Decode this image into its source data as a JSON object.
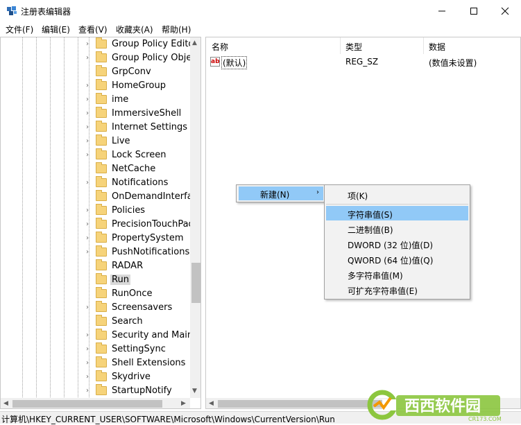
{
  "window": {
    "title": "注册表编辑器",
    "controls": [
      "minimize",
      "maximize",
      "close"
    ]
  },
  "menubar": [
    {
      "label": "文件(F)"
    },
    {
      "label": "编辑(E)"
    },
    {
      "label": "查看(V)"
    },
    {
      "label": "收藏夹(A)"
    },
    {
      "label": "帮助(H)"
    }
  ],
  "tree": {
    "items": [
      {
        "label": "Group Policy Editor",
        "expandable": true
      },
      {
        "label": "Group Policy Objects",
        "expandable": true
      },
      {
        "label": "GrpConv",
        "expandable": false
      },
      {
        "label": "HomeGroup",
        "expandable": true
      },
      {
        "label": "ime",
        "expandable": true
      },
      {
        "label": "ImmersiveShell",
        "expandable": true
      },
      {
        "label": "Internet Settings",
        "expandable": true
      },
      {
        "label": "Live",
        "expandable": true
      },
      {
        "label": "Lock Screen",
        "expandable": true
      },
      {
        "label": "NetCache",
        "expandable": false
      },
      {
        "label": "Notifications",
        "expandable": true
      },
      {
        "label": "OnDemandInterfaceCache",
        "expandable": false
      },
      {
        "label": "Policies",
        "expandable": true
      },
      {
        "label": "PrecisionTouchPad",
        "expandable": true
      },
      {
        "label": "PropertySystem",
        "expandable": true
      },
      {
        "label": "PushNotifications",
        "expandable": true
      },
      {
        "label": "RADAR",
        "expandable": false
      },
      {
        "label": "Run",
        "expandable": false,
        "selected": true
      },
      {
        "label": "RunOnce",
        "expandable": false
      },
      {
        "label": "Screensavers",
        "expandable": true
      },
      {
        "label": "Search",
        "expandable": false
      },
      {
        "label": "Security and Maintenance",
        "expandable": true
      },
      {
        "label": "SettingSync",
        "expandable": true
      },
      {
        "label": "Shell Extensions",
        "expandable": true
      },
      {
        "label": "Skydrive",
        "expandable": true
      },
      {
        "label": "StartupNotify",
        "expandable": true
      }
    ]
  },
  "list": {
    "columns": {
      "name": "名称",
      "type": "类型",
      "data": "数据"
    },
    "rows": [
      {
        "name": "(默认)",
        "type": "REG_SZ",
        "data": "(数值未设置)"
      }
    ]
  },
  "context_menu": {
    "parent_label": "新建(N)",
    "submenu": [
      {
        "label": "项(K)"
      },
      {
        "label": "字符串值(S)",
        "highlighted": true
      },
      {
        "label": "二进制值(B)"
      },
      {
        "label": "DWORD (32 位)值(D)"
      },
      {
        "label": "QWORD (64 位)值(Q)"
      },
      {
        "label": "多字符串值(M)"
      },
      {
        "label": "可扩充字符串值(E)"
      }
    ]
  },
  "statusbar": {
    "path": "计算机\\HKEY_CURRENT_USER\\SOFTWARE\\Microsoft\\Windows\\CurrentVersion\\Run"
  },
  "watermark": {
    "text": "西西软件园",
    "sub": "CR173.COM"
  },
  "colors": {
    "highlight": "#91c9f7",
    "folder": "#f6d37a",
    "watermark_green": "#8cc63f",
    "watermark_orange": "#f39800"
  }
}
